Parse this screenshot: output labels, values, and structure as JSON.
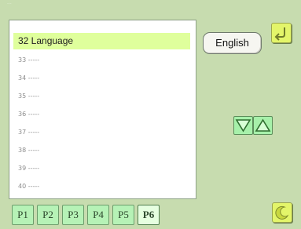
{
  "screen": {
    "top_mark": "···"
  },
  "list": {
    "selected_label": "32 Language",
    "items": [
      "33 -----",
      "34 -----",
      "35 -----",
      "36 -----",
      "37 -----",
      "38 -----",
      "39 -----",
      "40 -----"
    ]
  },
  "language_button": {
    "label": "English"
  },
  "corner_buttons": {
    "top_icon": "return-icon",
    "bottom_icon": "moon-icon",
    "color": "#e3f56a"
  },
  "arrows": {
    "down_icon": "triangle-down-icon",
    "up_icon": "triangle-up-icon"
  },
  "page_tabs": [
    "P1",
    "P2",
    "P3",
    "P4",
    "P5",
    "P6"
  ],
  "active_page": "P6",
  "colors": {
    "background": "#c7dcaf",
    "selected_row": "#dfff9c",
    "tab": "#b6f2b6"
  }
}
